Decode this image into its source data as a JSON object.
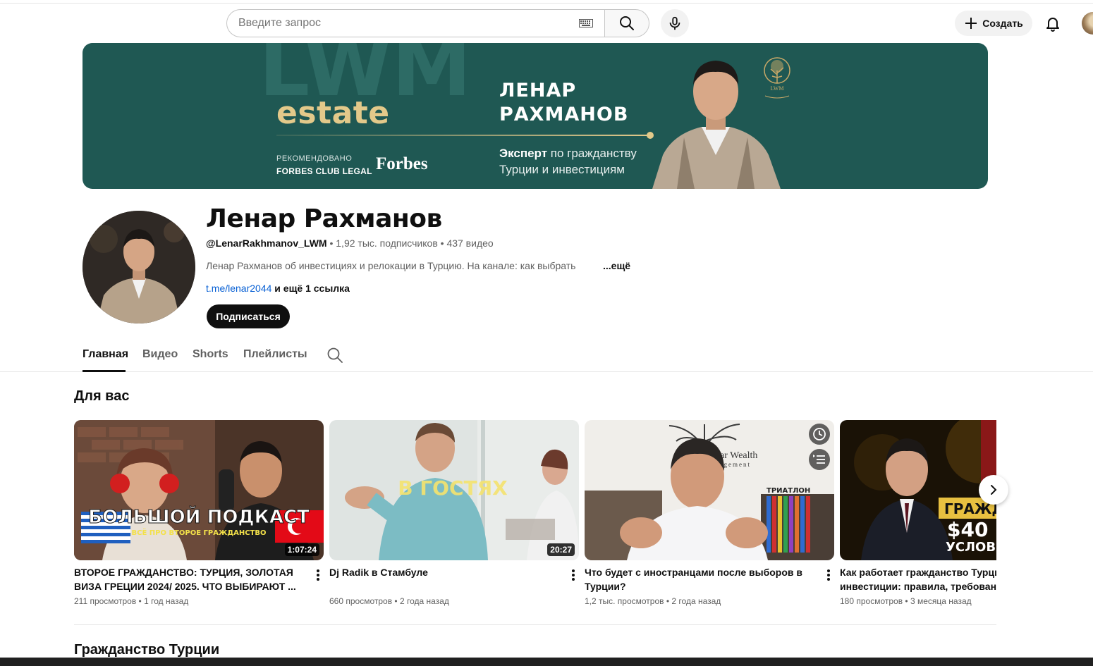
{
  "search": {
    "placeholder": "Введите запрос"
  },
  "header": {
    "create_label": "Создать"
  },
  "banner": {
    "watermark": "LWM",
    "estate": "estate",
    "recommended": "РЕКОМЕНДОВАНО",
    "club": "FORBES CLUB LEGAL",
    "forbes": "Forbes",
    "name_line1": "ЛЕНАР",
    "name_line2": "РАХМАНОВ",
    "expert_bold": "Эксперт",
    "expert_rest": " по гражданству",
    "expert_line2": "Турции и инвестициям",
    "logo_text": "LWM"
  },
  "channel": {
    "title": "Ленар Рахманов",
    "handle": "@LenarRakhmanov_LWM",
    "subscribers": "1,92 тыс. подписчиков",
    "videos": "437 видео",
    "description": "Ленар Рахманов об инвестициях и релокации в Турцию. На канале: как выбрать",
    "more": "...ещё",
    "link": "t.me/lenar2044",
    "more_links": " и ещё 1 ссылка",
    "subscribe_label": "Подписаться"
  },
  "tabs": [
    "Главная",
    "Видео",
    "Shorts",
    "Плейлисты"
  ],
  "section": {
    "title": "Для вас",
    "videos": [
      {
        "title": "ВТОРОЕ ГРАЖДАНСТВО: ТУРЦИЯ, ЗОЛОТАЯ ВИЗА ГРЕЦИИ 2024/ 2025. ЧТО ВЫБИРАЮТ ...",
        "views": "211 просмотров",
        "age": "1 год назад",
        "duration": "1:07:24",
        "thumb_text": "БОЛЬШОЙ ПОДКАСТ",
        "thumb_sub": "ВСЁ ПРО ВТОРОЕ ГРАЖДАНСТВО"
      },
      {
        "title": "Dj Radik в Стамбуле",
        "views": "660 просмотров",
        "age": "2 года назад",
        "duration": "20:27",
        "thumb_text": "В ГОСТЯХ"
      },
      {
        "title": "Что будет с иностранцами после выборов в Турции?",
        "views": "1,2 тыс. просмотров",
        "age": "2 года назад",
        "thumb_text": "nar Wealth",
        "thumb_sub": "nagement",
        "thumb_sign": "ТРИАТЛОН"
      },
      {
        "title": "Как работает гражданство Турции инвестиции: правила, требования",
        "views": "180 просмотров",
        "age": "3 месяца назад",
        "thumb_text1": "ГРАЖДАН",
        "thumb_text2": "$40",
        "thumb_text3": "УСЛОВИЯ"
      }
    ]
  },
  "section2": {
    "title": "Гражданство Турции"
  },
  "colors": {
    "banner_bg": "#1f5853",
    "gold": "#e3c98a",
    "link": "#065fd4"
  }
}
